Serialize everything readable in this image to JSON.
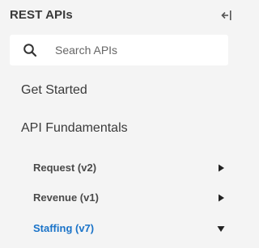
{
  "header": {
    "title": "REST APIs"
  },
  "search": {
    "placeholder": "Search APIs",
    "value": ""
  },
  "nav": {
    "items": [
      {
        "label": "Get Started"
      },
      {
        "label": "API Fundamentals"
      }
    ],
    "sub_items": [
      {
        "label": "Request (v2)",
        "state": "collapsed",
        "active": false
      },
      {
        "label": "Revenue (v1)",
        "state": "collapsed",
        "active": false
      },
      {
        "label": "Staffing (v7)",
        "state": "expanded",
        "active": true
      }
    ]
  },
  "colors": {
    "background": "#f4f4f4",
    "active_link": "#1a73c8",
    "text": "#3a3a3a"
  }
}
